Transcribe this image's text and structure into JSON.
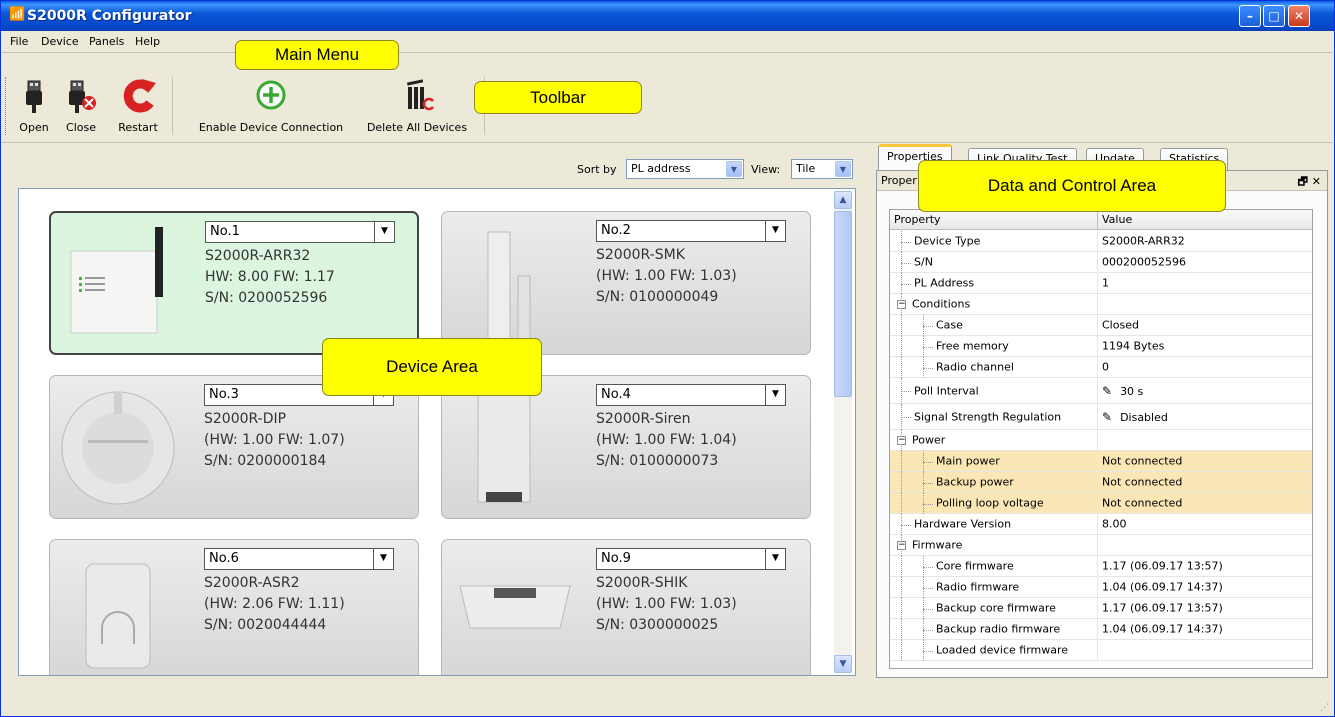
{
  "window": {
    "title": "S2000R Configurator"
  },
  "menu": [
    "File",
    "Device",
    "Panels",
    "Help"
  ],
  "annotations": {
    "main_menu": "Main Menu",
    "toolbar": "Toolbar",
    "device_area": "Device Area",
    "data_control": "Data and Control Area"
  },
  "toolbar": {
    "open": "Open",
    "close": "Close",
    "restart": "Restart",
    "enable": "Enable Device Connection",
    "delete_all": "Delete All Devices"
  },
  "sort": {
    "label": "Sort by",
    "value": "PL address",
    "view_label": "View:",
    "view_value": "Tile"
  },
  "devices": [
    {
      "number": "No.1",
      "model": "S2000R-ARR32",
      "hwfw": "HW: 8.00 FW: 1.17",
      "sn": "S/N: 0200052596",
      "selected": true
    },
    {
      "number": "No.2",
      "model": "S2000R-SMK",
      "hwfw": "(HW: 1.00 FW: 1.03)",
      "sn": "S/N: 0100000049",
      "selected": false
    },
    {
      "number": "No.3",
      "model": "S2000R-DIP",
      "hwfw": "(HW: 1.00 FW: 1.07)",
      "sn": "S/N: 0200000184",
      "selected": false
    },
    {
      "number": "No.4",
      "model": "S2000R-Siren",
      "hwfw": "(HW: 1.00 FW: 1.04)",
      "sn": "S/N: 0100000073",
      "selected": false
    },
    {
      "number": "No.6",
      "model": "S2000R-ASR2",
      "hwfw": "(HW: 2.06 FW: 1.11)",
      "sn": "S/N: 0020044444",
      "selected": false
    },
    {
      "number": "No.9",
      "model": "S2000R-SHIK",
      "hwfw": "(HW: 1.00 FW: 1.03)",
      "sn": "S/N: 0300000025",
      "selected": false
    }
  ],
  "tabs": [
    "Properties",
    "Link Quality Test",
    "Update",
    "Statistics"
  ],
  "panel_header": "Proper",
  "grid": {
    "col_property": "Property",
    "col_value": "Value",
    "rows": [
      {
        "label": "Device Type",
        "value": "S2000R-ARR32"
      },
      {
        "label": "S/N",
        "value": "000200052596"
      },
      {
        "label": "PL Address",
        "value": "1"
      },
      {
        "label": "Conditions",
        "value": ""
      },
      {
        "label": "Case",
        "value": "Closed"
      },
      {
        "label": "Free memory",
        "value": "1194 Bytes"
      },
      {
        "label": "Radio channel",
        "value": "0"
      },
      {
        "label": "Poll Interval",
        "value": "30 s"
      },
      {
        "label": "Signal Strength Regulation",
        "value": "Disabled"
      },
      {
        "label": "Power",
        "value": ""
      },
      {
        "label": "Main power",
        "value": "Not connected"
      },
      {
        "label": "Backup power",
        "value": "Not connected"
      },
      {
        "label": "Polling loop voltage",
        "value": "Not connected"
      },
      {
        "label": "Hardware Version",
        "value": "8.00"
      },
      {
        "label": "Firmware",
        "value": ""
      },
      {
        "label": "Core firmware",
        "value": "1.17 (06.09.17  13:57)"
      },
      {
        "label": "Radio firmware",
        "value": "1.04 (06.09.17 14:37)"
      },
      {
        "label": "Backup core firmware",
        "value": "1.17 (06.09.17 13:57)"
      },
      {
        "label": "Backup radio firmware",
        "value": "1.04 (06.09.17 14:37)"
      },
      {
        "label": "Loaded device firmware",
        "value": ""
      }
    ]
  },
  "colors": {
    "accent": "#0a58d8",
    "highlight_row": "#fbe7b5",
    "selected_tile": "#dcf5de",
    "callout": "#ffff00"
  }
}
